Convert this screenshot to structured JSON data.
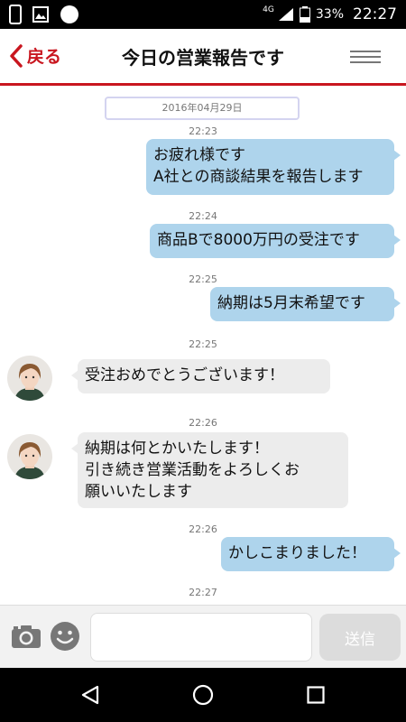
{
  "status_bar": {
    "network": "4G",
    "battery": "33%",
    "time": "22:27"
  },
  "header": {
    "back_label": "戻る",
    "title": "今日の営業報告です"
  },
  "chat": {
    "date": "2016年04月29日",
    "messages": [
      {
        "time": "22:23",
        "sender": "me",
        "lines": [
          "お疲れ様です",
          "A社との商談結果を報告します"
        ]
      },
      {
        "time": "22:24",
        "sender": "me",
        "lines": [
          "商品Bで8000万円の受注です"
        ]
      },
      {
        "time": "22:25",
        "sender": "me",
        "lines": [
          "納期は5月末希望です"
        ]
      },
      {
        "time": "22:25",
        "sender": "other",
        "lines": [
          "受注おめでとうございます！"
        ]
      },
      {
        "time": "22:26",
        "sender": "other",
        "lines": [
          "納期は何とかいたします！",
          "引き続き営業活動をよろしくお",
          "願いいたします"
        ]
      },
      {
        "time": "22:26",
        "sender": "me",
        "lines": [
          "かしこまりました！"
        ]
      },
      {
        "time": "22:27",
        "sender": "me",
        "lines": []
      }
    ]
  },
  "input_bar": {
    "message_value": "",
    "placeholder": "",
    "send_label": "送信"
  },
  "colors": {
    "accent": "#c9161f",
    "outgoing_bubble": "#aed4ec",
    "incoming_bubble": "#ececec"
  }
}
